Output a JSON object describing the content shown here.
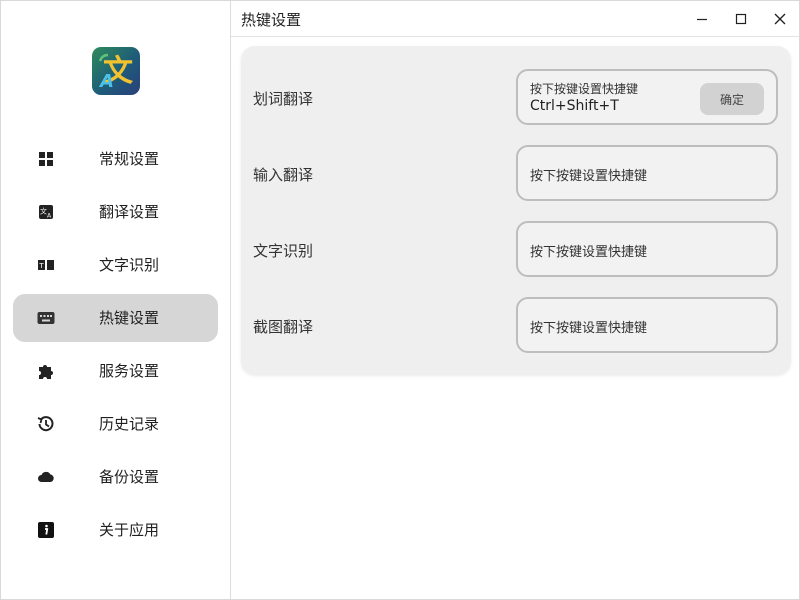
{
  "window": {
    "title": "热键设置"
  },
  "sidebar": {
    "items": [
      {
        "label": "常规设置",
        "icon": "grid-icon",
        "active": false
      },
      {
        "label": "翻译设置",
        "icon": "translate-icon",
        "active": false
      },
      {
        "label": "文字识别",
        "icon": "ocr-icon",
        "active": false
      },
      {
        "label": "热键设置",
        "icon": "keyboard-icon",
        "active": true
      },
      {
        "label": "服务设置",
        "icon": "puzzle-icon",
        "active": false
      },
      {
        "label": "历史记录",
        "icon": "history-icon",
        "active": false
      },
      {
        "label": "备份设置",
        "icon": "cloud-icon",
        "active": false
      },
      {
        "label": "关于应用",
        "icon": "info-icon",
        "active": false
      }
    ]
  },
  "hotkeys": {
    "placeholder": "按下按键设置快捷键",
    "confirm_label": "确定",
    "rows": [
      {
        "label": "划词翻译",
        "value": "Ctrl+Shift+T"
      },
      {
        "label": "输入翻译",
        "value": ""
      },
      {
        "label": "文字识别",
        "value": ""
      },
      {
        "label": "截图翻译",
        "value": ""
      }
    ]
  },
  "colors": {
    "active_nav_bg": "#d6d6d6",
    "card_bg": "#efefef",
    "input_border": "#bdbdbd"
  }
}
